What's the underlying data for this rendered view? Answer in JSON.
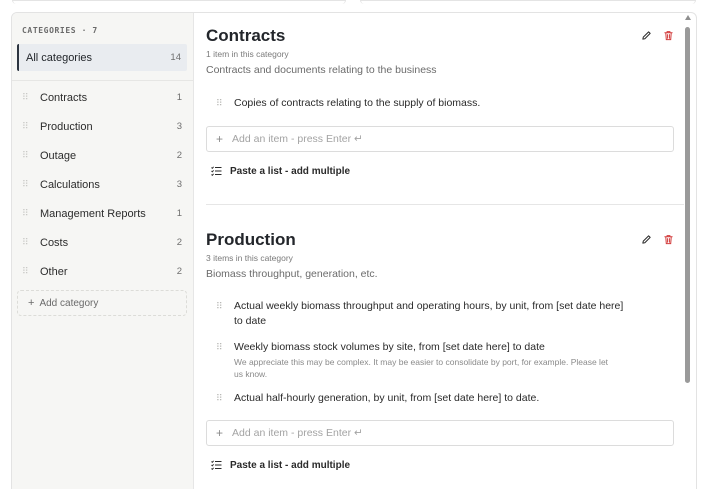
{
  "sidebar": {
    "header": "CATEGORIES · 7",
    "all": {
      "label": "All categories",
      "count": "14"
    },
    "items": [
      {
        "label": "Contracts",
        "count": "1"
      },
      {
        "label": "Production",
        "count": "3"
      },
      {
        "label": "Outage",
        "count": "2"
      },
      {
        "label": "Calculations",
        "count": "3"
      },
      {
        "label": "Management Reports",
        "count": "1"
      },
      {
        "label": "Costs",
        "count": "2"
      },
      {
        "label": "Other",
        "count": "2"
      }
    ],
    "add_label": "Add category"
  },
  "sections": [
    {
      "title": "Contracts",
      "count": "1 item in this category",
      "description": "Contracts and documents relating to the business",
      "items": [
        {
          "text": "Copies of contracts relating to the supply of biomass."
        }
      ],
      "add_placeholder": "Add an item - press Enter ↵",
      "paste_label": "Paste a list - add multiple"
    },
    {
      "title": "Production",
      "count": "3 items in this category",
      "description": "Biomass throughput, generation, etc.",
      "items": [
        {
          "text": "Actual weekly biomass throughput and operating hours, by unit, from [set date here] to date"
        },
        {
          "text": "Weekly biomass stock volumes by site, from [set date here] to date",
          "note": "We appreciate this may be complex. It may be easier to consolidate by port, for example. Please let us know."
        },
        {
          "text": "Actual half-hourly generation, by unit, from [set date here] to date."
        }
      ],
      "add_placeholder": "Add an item - press Enter ↵",
      "paste_label": "Paste a list - add multiple"
    }
  ],
  "icons": {
    "edit": "pencil-icon",
    "delete": "trash-icon",
    "grip": "drag-handle-icon",
    "plus": "plus-icon",
    "list": "list-icon"
  },
  "colors": {
    "delete": "#d23b3b",
    "active_border": "#2c3440"
  }
}
